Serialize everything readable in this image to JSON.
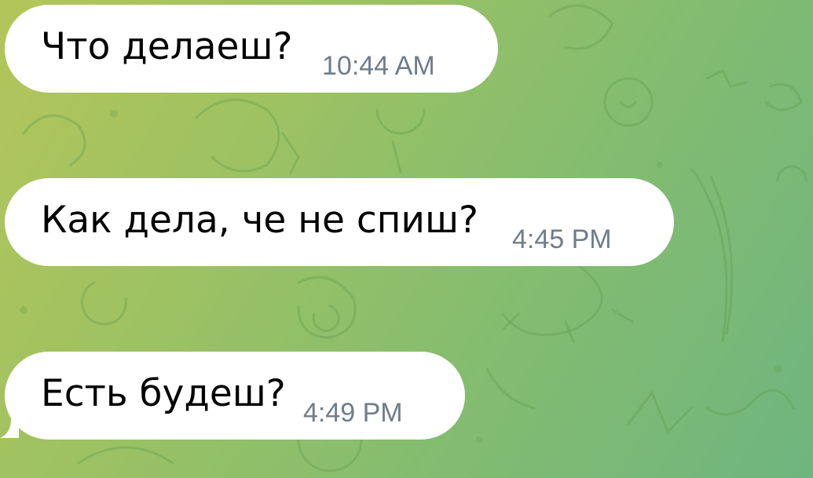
{
  "chat": {
    "messages": [
      {
        "text": "Что делаеш?",
        "time": "10:44 AM"
      },
      {
        "text": "Как дела, че не спиш?",
        "time": "4:45 PM"
      },
      {
        "text": "Есть будеш?",
        "time": "4:49 PM"
      }
    ]
  },
  "colors": {
    "bubble": "#ffffff",
    "text": "#000000",
    "timestamp": "#6f7d8a",
    "wallpaper_start": "#b3c55a",
    "wallpaper_end": "#6fb57f"
  }
}
